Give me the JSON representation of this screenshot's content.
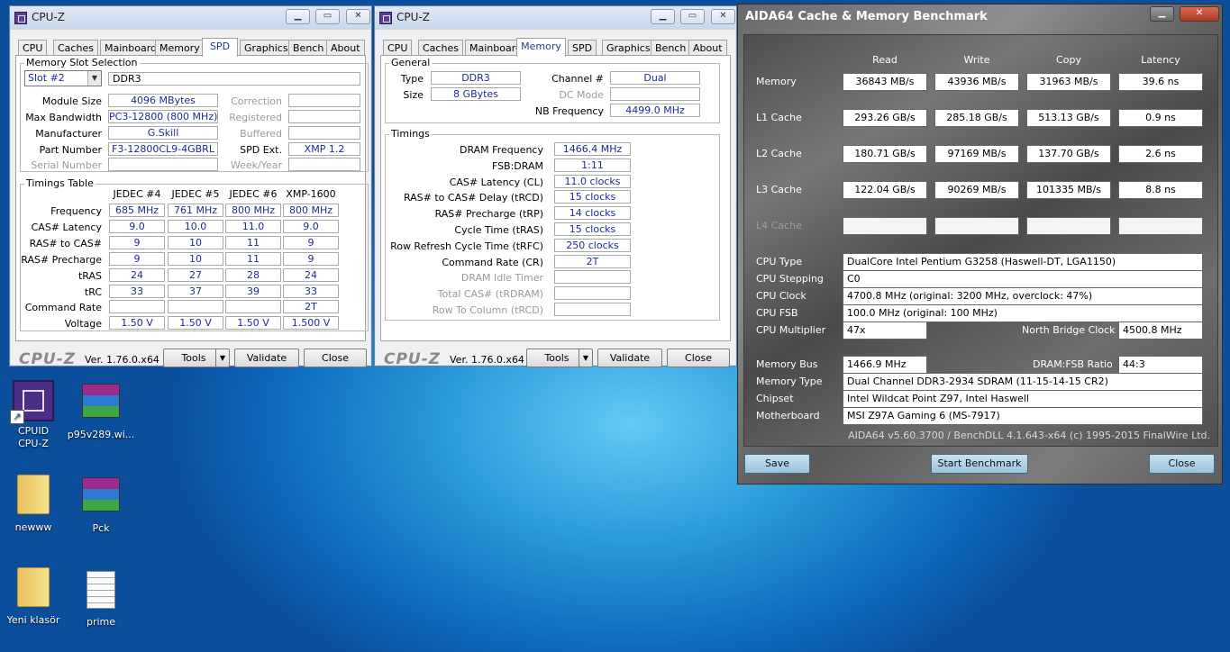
{
  "cpuz_spd": {
    "title": "CPU-Z",
    "tabs": [
      "CPU",
      "Caches",
      "Mainboard",
      "Memory",
      "SPD",
      "Graphics",
      "Bench",
      "About"
    ],
    "slot_group": "Memory Slot Selection",
    "slot": "Slot #2",
    "type": "DDR3",
    "module_size_label": "Module Size",
    "module_size": "4096 MBytes",
    "max_bw_label": "Max Bandwidth",
    "max_bw": "PC3-12800 (800 MHz)",
    "manufacturer_label": "Manufacturer",
    "manufacturer": "G.Skill",
    "part_label": "Part Number",
    "part": "F3-12800CL9-4GBRL",
    "serial_label": "Serial Number",
    "correction_label": "Correction",
    "registered_label": "Registered",
    "buffered_label": "Buffered",
    "spd_ext_label": "SPD Ext.",
    "spd_ext": "XMP 1.2",
    "week_label": "Week/Year",
    "timings_group": "Timings Table",
    "columns": [
      "JEDEC #4",
      "JEDEC #5",
      "JEDEC #6",
      "XMP-1600"
    ],
    "rows": [
      {
        "label": "Frequency",
        "v": [
          "685 MHz",
          "761 MHz",
          "800 MHz",
          "800 MHz"
        ]
      },
      {
        "label": "CAS# Latency",
        "v": [
          "9.0",
          "10.0",
          "11.0",
          "9.0"
        ]
      },
      {
        "label": "RAS# to CAS#",
        "v": [
          "9",
          "10",
          "11",
          "9"
        ]
      },
      {
        "label": "RAS# Precharge",
        "v": [
          "9",
          "10",
          "11",
          "9"
        ]
      },
      {
        "label": "tRAS",
        "v": [
          "24",
          "27",
          "28",
          "24"
        ]
      },
      {
        "label": "tRC",
        "v": [
          "33",
          "37",
          "39",
          "33"
        ]
      },
      {
        "label": "Command Rate",
        "v": [
          "",
          "",
          "",
          "2T"
        ]
      },
      {
        "label": "Voltage",
        "v": [
          "1.50 V",
          "1.50 V",
          "1.50 V",
          "1.500 V"
        ]
      }
    ],
    "logo": "CPU-Z",
    "version": "Ver. 1.76.0.x64",
    "tools": "Tools",
    "validate": "Validate",
    "close": "Close"
  },
  "cpuz_mem": {
    "title": "CPU-Z",
    "tabs": [
      "CPU",
      "Caches",
      "Mainboard",
      "Memory",
      "SPD",
      "Graphics",
      "Bench",
      "About"
    ],
    "general_group": "General",
    "type_label": "Type",
    "type": "DDR3",
    "size_label": "Size",
    "size": "8 GBytes",
    "channel_label": "Channel #",
    "channel": "Dual",
    "dc_label": "DC Mode",
    "nb_label": "NB Frequency",
    "nb": "4499.0 MHz",
    "timings_group": "Timings",
    "timings": [
      {
        "label": "DRAM Frequency",
        "v": "1466.4 MHz",
        "gray": false
      },
      {
        "label": "FSB:DRAM",
        "v": "1:11",
        "gray": false
      },
      {
        "label": "CAS# Latency (CL)",
        "v": "11.0 clocks",
        "gray": false
      },
      {
        "label": "RAS# to CAS# Delay (tRCD)",
        "v": "15 clocks",
        "gray": false
      },
      {
        "label": "RAS# Precharge (tRP)",
        "v": "14 clocks",
        "gray": false
      },
      {
        "label": "Cycle Time (tRAS)",
        "v": "15 clocks",
        "gray": false
      },
      {
        "label": "Row Refresh Cycle Time (tRFC)",
        "v": "250 clocks",
        "gray": false
      },
      {
        "label": "Command Rate (CR)",
        "v": "2T",
        "gray": false
      },
      {
        "label": "DRAM Idle Timer",
        "v": "",
        "gray": true
      },
      {
        "label": "Total CAS# (tRDRAM)",
        "v": "",
        "gray": true
      },
      {
        "label": "Row To Column (tRCD)",
        "v": "",
        "gray": true
      }
    ],
    "logo": "CPU-Z",
    "version": "Ver. 1.76.0.x64",
    "tools": "Tools",
    "validate": "Validate",
    "close": "Close"
  },
  "aida": {
    "title": "AIDA64 Cache & Memory Benchmark",
    "headers": [
      "Read",
      "Write",
      "Copy",
      "Latency"
    ],
    "bench": [
      {
        "label": "Memory",
        "v": [
          "36843 MB/s",
          "43936 MB/s",
          "31963 MB/s",
          "39.6 ns"
        ],
        "dim": false
      },
      {
        "label": "L1 Cache",
        "v": [
          "293.26 GB/s",
          "285.18 GB/s",
          "513.13 GB/s",
          "0.9 ns"
        ],
        "dim": false
      },
      {
        "label": "L2 Cache",
        "v": [
          "180.71 GB/s",
          "97169 MB/s",
          "137.70 GB/s",
          "2.6 ns"
        ],
        "dim": false
      },
      {
        "label": "L3 Cache",
        "v": [
          "122.04 GB/s",
          "90269 MB/s",
          "101335 MB/s",
          "8.8 ns"
        ],
        "dim": false
      },
      {
        "label": "L4 Cache",
        "v": [
          "",
          "",
          "",
          ""
        ],
        "dim": true
      }
    ],
    "cpu_type_label": "CPU Type",
    "cpu_type": "DualCore Intel Pentium G3258  (Haswell-DT, LGA1150)",
    "cpu_stepping_label": "CPU Stepping",
    "cpu_stepping": "C0",
    "cpu_clock_label": "CPU Clock",
    "cpu_clock": "4700.8 MHz  (original: 3200 MHz, overclock: 47%)",
    "cpu_fsb_label": "CPU FSB",
    "cpu_fsb": "100.0 MHz  (original: 100 MHz)",
    "cpu_mult_label": "CPU Multiplier",
    "cpu_mult": "47x",
    "nb_clock_label": "North Bridge Clock",
    "nb_clock": "4500.8 MHz",
    "mem_bus_label": "Memory Bus",
    "mem_bus": "1466.9 MHz",
    "ratio_label": "DRAM:FSB Ratio",
    "ratio": "44:3",
    "mem_type_label": "Memory Type",
    "mem_type": "Dual Channel DDR3-2934 SDRAM  (11-15-14-15 CR2)",
    "chipset_label": "Chipset",
    "chipset": "Intel Wildcat Point Z97, Intel Haswell",
    "mobo_label": "Motherboard",
    "mobo": "MSI Z97A Gaming 6 (MS-7917)",
    "footer": "AIDA64 v5.60.3700 / BenchDLL 4.1.643-x64  (c) 1995-2015 FinalWire Ltd.",
    "save": "Save",
    "start": "Start Benchmark",
    "close": "Close"
  },
  "desktop": [
    {
      "label": "CPUID\nCPU-Z",
      "icon": "cpuz-icon"
    },
    {
      "label": "p95v289.wi...",
      "icon": "winrar-icon"
    },
    {
      "label": "newww",
      "icon": "folder-icon"
    },
    {
      "label": "Pck",
      "icon": "winrar-icon"
    },
    {
      "label": "Yeni klasör",
      "icon": "folder-icon"
    },
    {
      "label": "prime",
      "icon": "text-file-icon"
    }
  ]
}
